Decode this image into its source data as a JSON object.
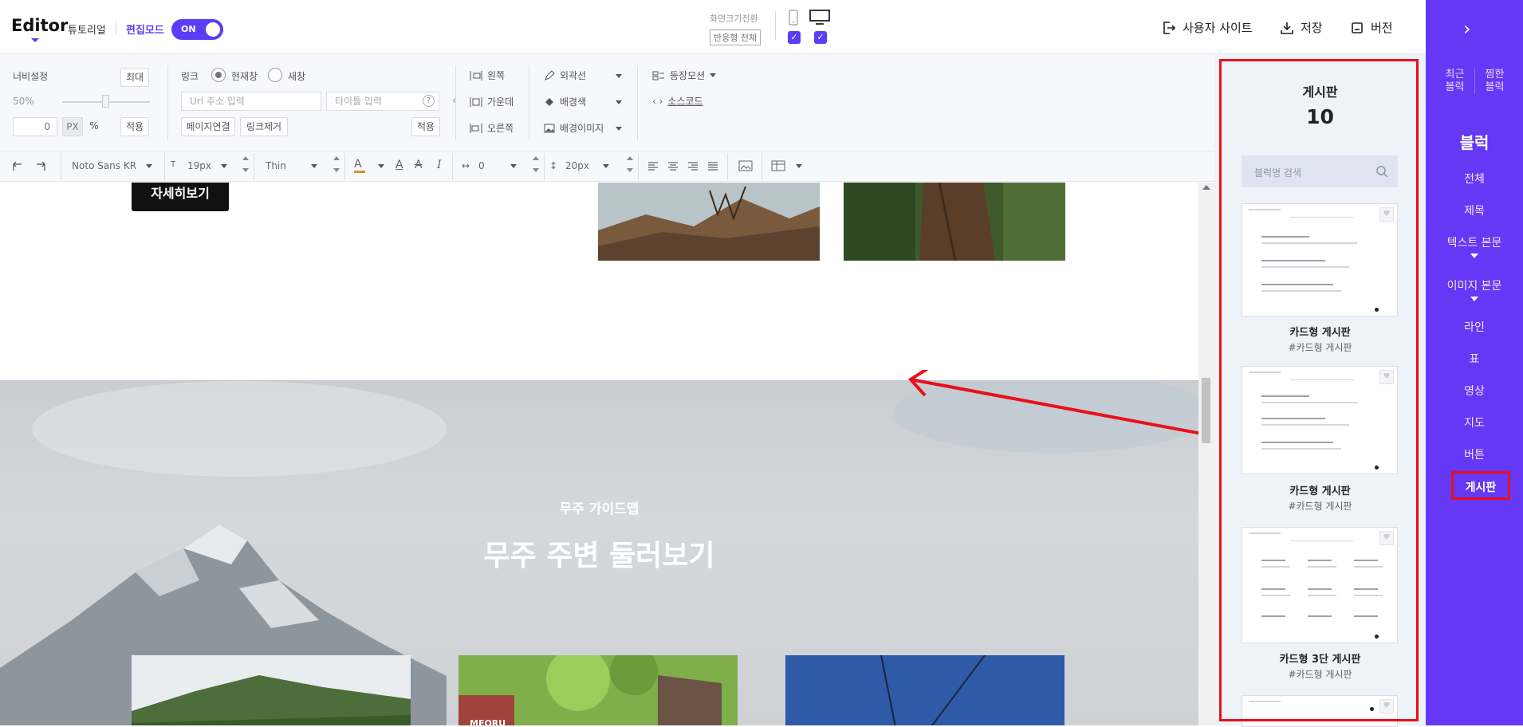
{
  "header": {
    "logo": "Editor",
    "tutorial": "튜토리얼",
    "edit_mode": "편집모드",
    "toggle_label": "ON",
    "screen_switch": "화면크기전환",
    "responsive_all": "반응형 전체",
    "user_site": "사용자 사이트",
    "save": "저장",
    "version": "버전"
  },
  "toolbar": {
    "width_setting": "너비설정",
    "max": "최대",
    "width_percent": "50%",
    "width_value": "0",
    "unit_px": "PX",
    "unit_percent": "%",
    "apply": "적용",
    "link": "링크",
    "current_window": "현재창",
    "new_window": "새창",
    "url_placeholder": "Url 주소 입력",
    "title_placeholder": "타이틀 입력",
    "help": "?",
    "page_link": "페이지연결",
    "remove_link": "링크제거",
    "apply2": "적용",
    "align_left": "왼쪽",
    "align_center": "가운데",
    "align_right": "오른쪽",
    "border": "외곽선",
    "bg_color": "배경색",
    "bg_image": "배경이미지",
    "appear_motion": "등장모션",
    "source_code": "소스코드"
  },
  "toolbar2": {
    "font": "Noto Sans KR",
    "font_size": "19px",
    "font_weight": "Thin",
    "letter_spacing": "0",
    "line_height": "20px"
  },
  "canvas": {
    "detail_button": "자세히보기",
    "hero_subtitle": "무주 가이드맵",
    "hero_title": "무주 주변 둘러보기",
    "photo_sign": "MEORU"
  },
  "block_panel": {
    "title": "게시판",
    "count": "10",
    "search_placeholder": "블럭명 검색",
    "cards": [
      {
        "name": "카드형 게시판",
        "tag": "#카드형 게시판"
      },
      {
        "name": "카드형 게시판",
        "tag": "#카드형 게시판"
      },
      {
        "name": "카드형 3단 게시판",
        "tag": "#카드형 게시판"
      }
    ]
  },
  "sidebar": {
    "recent": "최근\n블럭",
    "favorite": "찜한\n블럭",
    "heading": "블럭",
    "items": [
      "전체",
      "제목",
      "텍스트 본문",
      "이미지 본문",
      "라인",
      "표",
      "영상",
      "지도",
      "버튼",
      "게시판"
    ]
  },
  "colors": {
    "accent": "#6438f5",
    "toggle": "#5b3df5",
    "highlight": "#e8101a",
    "panel_bg": "#eef2f9"
  }
}
